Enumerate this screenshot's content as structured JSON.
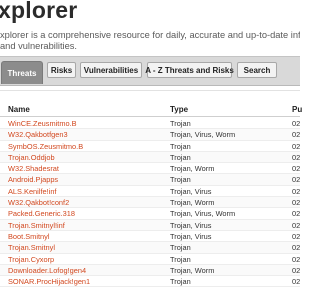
{
  "header": {
    "title": "xplorer",
    "intro_lines": [
      "xplorer is a comprehensive resource for daily, accurate and up-to-date information on th",
      "and vulnerabilities."
    ]
  },
  "tabs": [
    {
      "label": "Threats",
      "active": true
    },
    {
      "label": "Risks",
      "active": false
    },
    {
      "label": "Vulnerabilities",
      "active": false
    },
    {
      "label": "A - Z Threats and Risks",
      "active": false
    },
    {
      "label": "Search",
      "active": false
    }
  ],
  "table": {
    "columns": [
      "Name",
      "Type",
      "Pu"
    ],
    "rows": [
      {
        "name": "WinCE.Zeusmitmo.B",
        "type": "Trojan",
        "published": "02"
      },
      {
        "name": "W32.Qakbotfgen3",
        "type": "Trojan, Virus, Worm",
        "published": "02"
      },
      {
        "name": "SymbOS.Zeusmitmo.B",
        "type": "Trojan",
        "published": "02"
      },
      {
        "name": "Trojan.Oddjob",
        "type": "Trojan",
        "published": "02"
      },
      {
        "name": "W32.Shadesrat",
        "type": "Trojan, Worm",
        "published": "02"
      },
      {
        "name": "Android.Pjapps",
        "type": "Trojan",
        "published": "02"
      },
      {
        "name": "ALS.Kenilfe!inf",
        "type": "Trojan, Virus",
        "published": "02"
      },
      {
        "name": "W32.Qakbot!conf2",
        "type": "Trojan, Worm",
        "published": "02"
      },
      {
        "name": "Packed.Generic.318",
        "type": "Trojan, Virus, Worm",
        "published": "02"
      },
      {
        "name": "Trojan.Smitnyl!inf",
        "type": "Trojan, Virus",
        "published": "02"
      },
      {
        "name": "Boot.Smitnyl",
        "type": "Trojan, Virus",
        "published": "02"
      },
      {
        "name": "Trojan.Smitnyl",
        "type": "Trojan",
        "published": "02"
      },
      {
        "name": "Trojan.Cyxorp",
        "type": "Trojan",
        "published": "02"
      },
      {
        "name": "Downloader.Lofog!gen4",
        "type": "Trojan, Worm",
        "published": "02"
      },
      {
        "name": "SONAR.ProcHijack!gen1",
        "type": "Trojan",
        "published": "02"
      }
    ]
  }
}
